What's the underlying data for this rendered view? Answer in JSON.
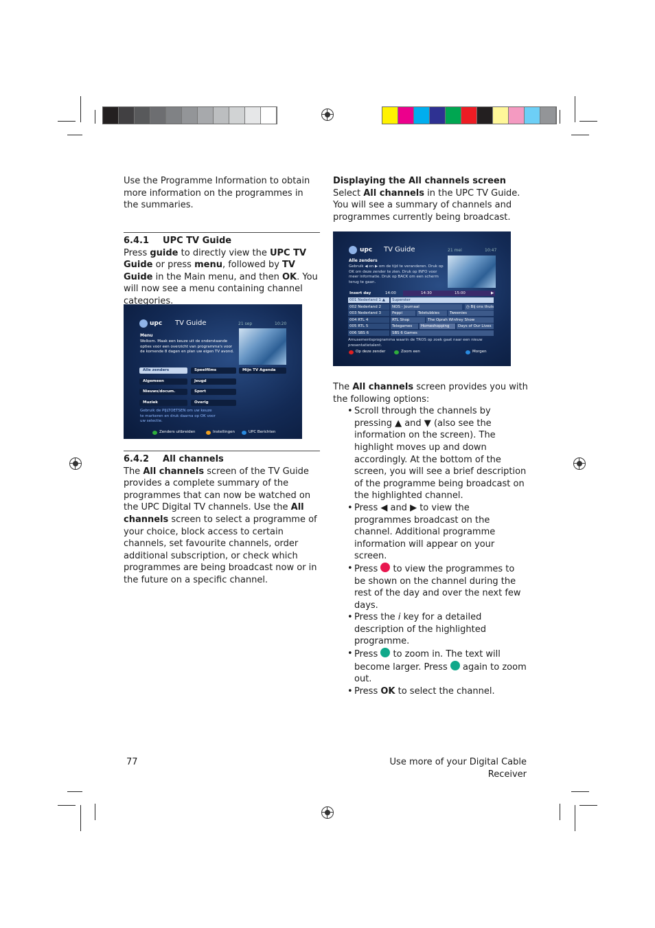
{
  "print_marks": {
    "grayscale": [
      "#231f20",
      "#414042",
      "#58595b",
      "#6d6e71",
      "#808285",
      "#939598",
      "#a7a9ac",
      "#bcbec0",
      "#d1d3d4",
      "#e6e7e8",
      "#ffffff"
    ],
    "color": [
      "#fff200",
      "#ec008c",
      "#00aeef",
      "#2e3192",
      "#00a651",
      "#ed1c24",
      "#231f20",
      "#fff799",
      "#f49ac1",
      "#6dcff6",
      "#939598"
    ]
  },
  "left": {
    "intro": "Use the Programme Information to obtain more information on the programmes in the summaries.",
    "s641": {
      "number": "6.4.1",
      "title": "UPC TV Guide",
      "body_html": "Press <b>guide</b> to directly view the <b>UPC TV Guide</b> or press <b>menu</b>, followed by <b>TV Guide</b> in the Main menu, and then <b>OK</b>. You will now see a menu containing channel categories."
    },
    "s642": {
      "number": "6.4.2",
      "title": "All channels",
      "body_html": "The <b>All channels</b> screen of the TV Guide provides a complete summary of the programmes that can now be watched on the UPC Digital TV channels. Use the <b>All channels</b> screen to select a programme of your choice, block access to certain channels, set favourite channels, order additional subscription, or check which programmes are being broadcast now or in the future on a specific channel."
    }
  },
  "screen1": {
    "brand": "upc",
    "title": "TV Guide",
    "date": "21 sep",
    "time": "10:20",
    "heading": "Menu",
    "description": "Welkom. Maak een keuze uit de onderstaande opties voor een overzicht van programma's voor de komende 8 dagen en plan uw eigen TV avond.",
    "menu": [
      [
        "Alle zenders",
        "Speelfilms",
        "Mijn TV Agenda"
      ],
      [
        "Algemeen",
        "Jeugd",
        ""
      ],
      [
        "Nieuws/docum.",
        "Sport",
        ""
      ],
      [
        "Muziek",
        "Overig",
        ""
      ]
    ],
    "hint": "Gebruik de PIJLTOETSEN om uw keuze te markeren en druk daarna op OK voor uw selectie.",
    "footer": [
      {
        "color": "#2fae3c",
        "label": "Zenders uitbreiden"
      },
      {
        "color": "#f0a020",
        "label": "Instellingen"
      },
      {
        "color": "#2a8be0",
        "label": "UPC Berichten"
      }
    ]
  },
  "right": {
    "heading": "Displaying the All channels screen",
    "intro_html": "Select <b>All channels</b> in the UPC TV Guide. You will see a summary of channels and programmes currently being broadcast.",
    "options_intro_html": "The <b>All channels</b> screen provides you with the following options:",
    "bullets_html": [
      "Scroll through the channels by pressing ▲ and ▼ (also see the information on the screen). The highlight moves up and down accordingly. At the bottom of the screen, you will see a brief description of the programme being broadcast on the highlighted channel.",
      "Press ◀ and ▶ to view the programmes broadcast on the channel. Additional programme information will appear on your screen.",
      "Press <span class=\"key\" style=\"background:#e8174f\"></span> to view the programmes to be shown on the channel during the rest of the day and over the next few days.",
      "Press the <i>i</i> key for a detailed description of the highlighted programme.",
      "Press <span class=\"key\" style=\"background:#0fa88a\"></span> to zoom in. The text will become larger. Press <span class=\"key\" style=\"background:#0fa88a\"></span> again to zoom out.",
      "Press <b>OK</b> to select the channel."
    ]
  },
  "screen2": {
    "brand": "upc",
    "title": "TV Guide",
    "date": "21 mei",
    "time": "10:47",
    "heading": "Alle zenders",
    "description": "Gebruik ◀ en ▶ om de tijd te veranderen. Druk op OK om deze zender te zien. Druk op INFO voor meer informatie. Druk op BACK om een scherm terug te gaan.",
    "header": {
      "day": "Insert day",
      "times": [
        "14:00",
        "14:30",
        "15:00"
      ]
    },
    "channels": [
      {
        "name": "001 Nederland 1",
        "programmes": [
          "Superster"
        ]
      },
      {
        "name": "002 Nederland 2",
        "programmes": [
          "NOS - Journaal",
          "Bij ons thuis"
        ]
      },
      {
        "name": "003 Nederland 3",
        "programmes": [
          "Peppi",
          "Teletubbies",
          "Tweenies"
        ]
      },
      {
        "name": "004 RTL 4",
        "programmes": [
          "RTL Shop",
          "The Oprah Winfrey Show"
        ]
      },
      {
        "name": "005 RTL 5",
        "programmes": [
          "Telegames",
          "Homeshopping",
          "Days of Our Lives"
        ]
      },
      {
        "name": "006 SBS 6",
        "programmes": [
          "SBS 6 Games"
        ]
      }
    ],
    "synopsis": "Amusementsprogramma waarin de TROS op zoek gaat naar een nieuw presentatietalent.",
    "footer": [
      {
        "color": "#e02020",
        "label": "Op deze zender"
      },
      {
        "color": "#2fae3c",
        "label": "Zoom een"
      },
      {
        "color": "#2a8be0",
        "label": "Morgen"
      }
    ]
  },
  "footer": {
    "page_number": "77",
    "section_title": "Use more of your Digital Cable Receiver"
  }
}
